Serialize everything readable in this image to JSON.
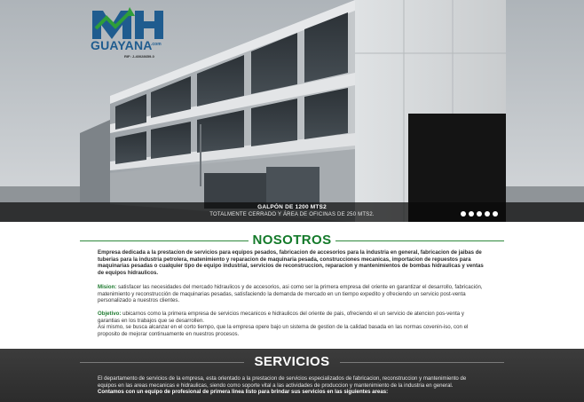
{
  "logo": {
    "mark": "MH",
    "wordmark": "GUAYANA",
    "domain": ".com",
    "rif": "RIF: J-40028659-0",
    "colors": {
      "blue": "#1f5c8f",
      "green": "#2e9e3a"
    }
  },
  "slider": {
    "caption_title": "GALPÓN DE 1200 MTS2",
    "caption_subtitle": "TOTALMENTE CERRADO Y ÁREA DE OFICINAS DE 250 MTS2.",
    "dot_count": 5
  },
  "nosotros": {
    "title": "NOSOTROS",
    "intro": "Empresa dedicada a la prestacion de servicios para equipos pesados, fabricacion de accesorios para la industria en general, fabricacion de jaibas de tuberias para la industria petrolera, matenimiento  y reparacion de maquinaria pesada, construcciones mecanicas, importacion de repuestos para maquinarias pesadas o cualquier tipo de equipo industrial,  servicios de reconstruccion, reparacion y mantenimientos de bombas hidraulicas y ventas de equipos hidraulicos.",
    "mision_label": "Mision:",
    "mision_text": " satisfacer las necesidades del mercado hidraulicos y de accesorios, asi como ser la primera empresa del oriente en garantizar el desarrollo, fabricación, matenimiento y reconstrucción de maquinarias pesadas, satisfaciendo la demanda de mercado en un tiempo expedito y ofreciendo un servicio post-venta personalizado a nuestros clientes.",
    "objetivo_label": "Objetivo:",
    "objetivo_text": " ubicarnos como la primera empresa de servicios mecanicos e hidraulicos del oriente de pais, ofreciendo el un servicio de atencion pos-venta y garantias en los trabajos que se desarrollen.",
    "objetivo_text2": "Asi mismo, se busca alcanzar en el corto tiempo, que la empresa opere bajo un sistema de gestion de la calidad basada en las normas covenin-iso, con el proposito de mejorar continuamente en nuestros procesos.",
    "title_color": "#147a2a"
  },
  "servicios": {
    "title": "SERVICIOS",
    "text": "El departamento de servicios de la empresa, esta orientado a la  prestacion de servicios especializados de fabricacion, reconstruccion y  mantenimiento de equipos en las areas mecanicas e hidraulicas,  siendo como soporte vital a las actividades de produccion y mantenimiento de la industria en general.",
    "text_bold": "Contamos con un equipo de profesional de primera linea listo para brindar sus servicios en las siguientes areas:"
  }
}
